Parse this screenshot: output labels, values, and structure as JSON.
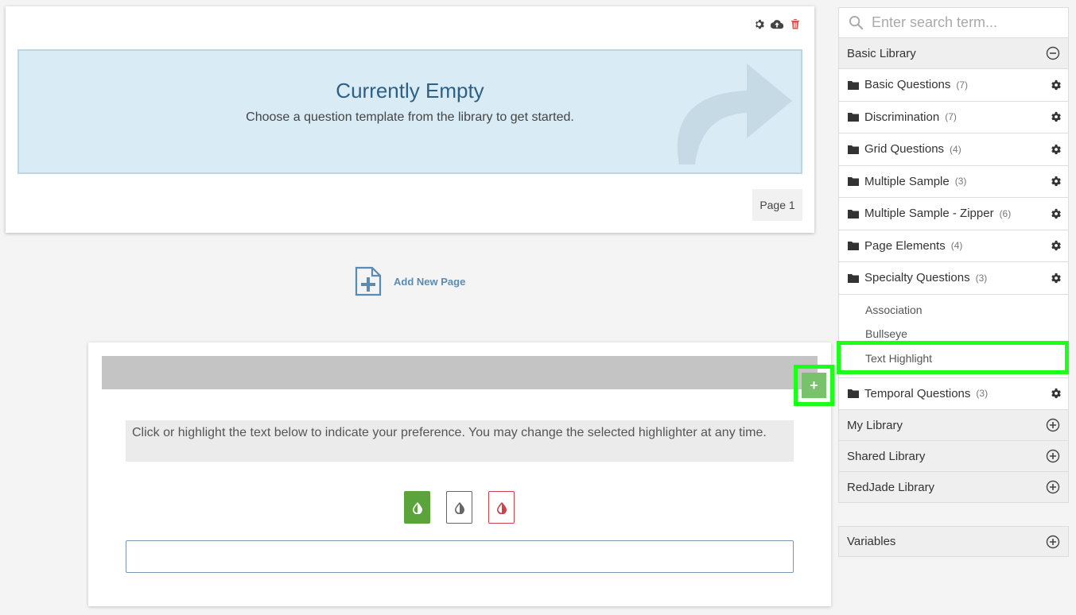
{
  "page_card": {
    "empty_title": "Currently Empty",
    "empty_subtitle": "Choose a question template from the library to get started.",
    "page_label": "Page 1"
  },
  "add_page": {
    "label": "Add New Page"
  },
  "question": {
    "add_symbol": "+",
    "instructions": "Click or highlight the text below to indicate your preference. You may change the selected highlighter at any time."
  },
  "sidebar": {
    "search_placeholder": "Enter search term...",
    "basic_library": {
      "label": "Basic Library",
      "folders": [
        {
          "name": "Basic Questions",
          "count": "(7)"
        },
        {
          "name": "Discrimination",
          "count": "(7)"
        },
        {
          "name": "Grid Questions",
          "count": "(4)"
        },
        {
          "name": "Multiple Sample",
          "count": "(3)"
        },
        {
          "name": "Multiple Sample - Zipper",
          "count": "(6)"
        },
        {
          "name": "Page Elements",
          "count": "(4)"
        },
        {
          "name": "Specialty Questions",
          "count": "(3)"
        }
      ],
      "specialty_items": [
        "Association",
        "Bullseye",
        "Text Highlight"
      ],
      "last_folder": {
        "name": "Temporal Questions",
        "count": "(3)"
      }
    },
    "my_library": "My Library",
    "shared_library": "Shared Library",
    "redjade_library": "RedJade Library",
    "variables": "Variables"
  },
  "colors": {
    "accent_green": "#1bff1b",
    "add_btn": "#77c26b",
    "empty_bg": "#d9ebf5",
    "title_blue": "#2e6085"
  }
}
